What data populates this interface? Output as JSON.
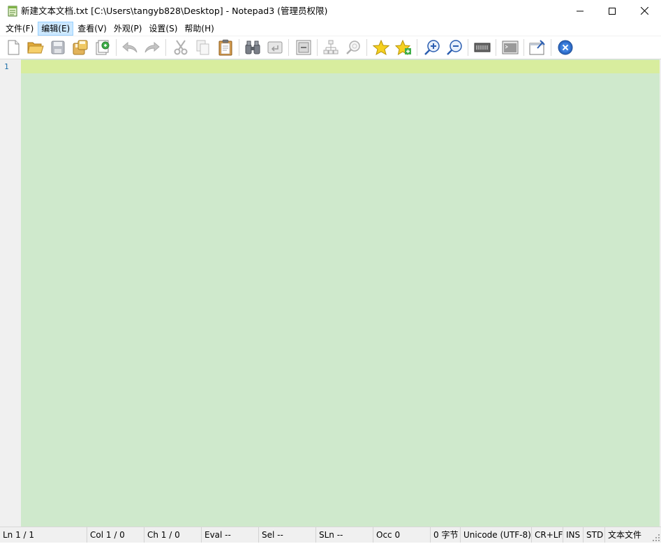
{
  "window": {
    "title": "新建文本文档.txt [C:\\Users\\tangyb828\\Desktop] - Notepad3  (管理员权限)"
  },
  "menu": [
    {
      "label": "文件(F)"
    },
    {
      "label": "编辑(E)"
    },
    {
      "label": "查看(V)"
    },
    {
      "label": "外观(P)"
    },
    {
      "label": "设置(S)"
    },
    {
      "label": "帮助(H)"
    }
  ],
  "toolbar": {
    "icons": [
      "new-file-icon",
      "open-folder-icon",
      "save-icon",
      "save-as-icon",
      "save-copy-icon",
      "undo-icon",
      "redo-icon",
      "cut-icon",
      "copy-icon",
      "paste-icon",
      "find-icon",
      "replace-icon",
      "goto-line-icon",
      "tree-icon",
      "zoom-find-icon",
      "favorite-icon",
      "add-favorite-icon",
      "zoom-in-icon",
      "zoom-out-icon",
      "monospace-icon",
      "terminal-icon",
      "pin-icon",
      "exit-icon"
    ]
  },
  "editor": {
    "line_number": "1",
    "content": "",
    "background_color": "#cfe9cc",
    "current_line_color": "#d8ed9e"
  },
  "statusbar": {
    "ln": "Ln  1 / 1",
    "col": "Col  1 / 0",
    "ch": "Ch  1 / 0",
    "eval": "Eval  --",
    "sel": "Sel  --",
    "sln": "SLn  --",
    "occ": "Occ  0",
    "bytes": "0 字节",
    "encoding": "Unicode (UTF-8)",
    "eol": "CR+LF",
    "ins": "INS",
    "std": "STD",
    "type": "文本文件"
  }
}
